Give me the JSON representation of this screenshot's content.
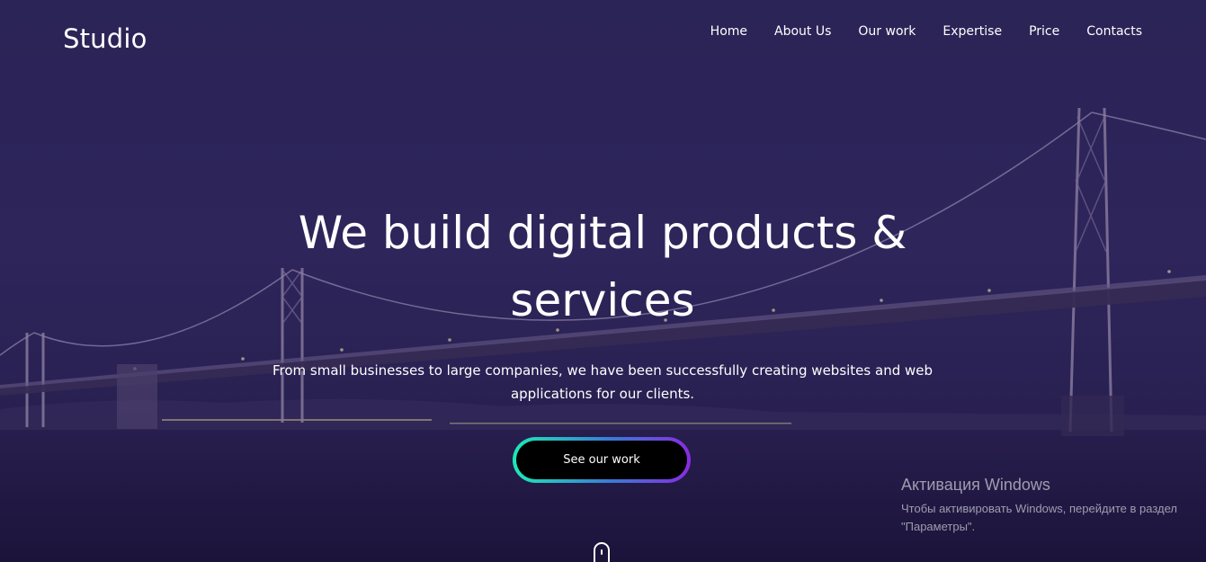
{
  "header": {
    "logo": "Studio",
    "nav": [
      "Home",
      "About Us",
      "Our work",
      "Expertise",
      "Price",
      "Contacts"
    ]
  },
  "hero": {
    "headline": "We build digital products & services",
    "subtext": "From small businesses to large companies, we have been successfully creating websites and web applications for our clients.",
    "cta_label": "See our work",
    "cta_gradient": [
      "#1de9b6",
      "#3a7bd5",
      "#8a2be2"
    ]
  },
  "windows_activation": {
    "title": "Активация Windows",
    "text": "Чтобы активировать Windows, перейдите в раздел \"Параметры\"."
  },
  "colors": {
    "background": "#2f2a5c",
    "text": "#ffffff"
  }
}
